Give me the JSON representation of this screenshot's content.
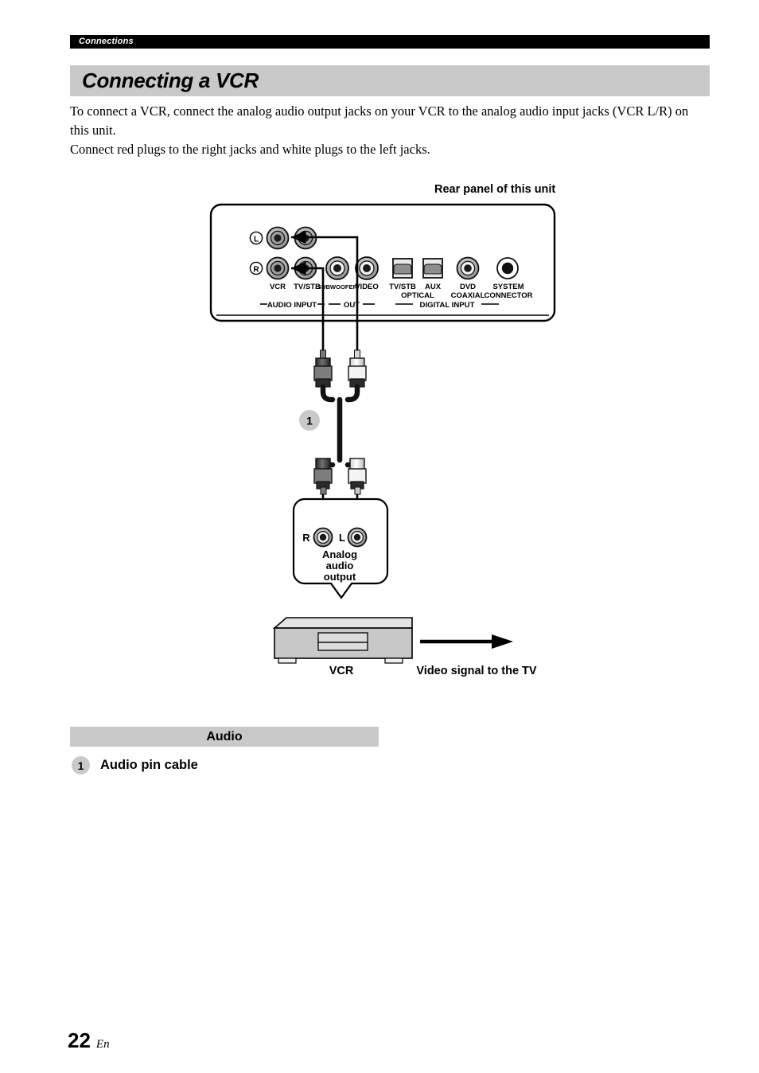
{
  "running_head": "Connections",
  "page_title": "Connecting a VCR",
  "intro": {
    "line1": "To connect a VCR, connect the analog audio output jacks on your VCR to the analog audio input jacks (VCR L/R) on",
    "line2": "this unit.",
    "line3": "Connect red plugs to the right jacks and white plugs to the left jacks."
  },
  "diagram": {
    "rear_panel_caption": "Rear panel of this unit",
    "channel_labels": {
      "left": "L",
      "right": "R"
    },
    "jack_labels": {
      "vcr": "VCR",
      "tv_stb": "TV/STB",
      "subwoofer": "SUBWOOFER",
      "video": "VIDEO",
      "optical_tv_stb": "TV/STB",
      "optical_aux": "AUX",
      "optical_word": "OPTICAL",
      "coaxial_dvd": "DVD",
      "coaxial_word": "COAXIAL",
      "system_line1": "SYSTEM",
      "system_line2": "CONNECTOR"
    },
    "group_labels": {
      "audio_input": "AUDIO INPUT",
      "out": "OUT",
      "digital_input": "DIGITAL INPUT"
    },
    "cable_badge": "1",
    "vcr_box": {
      "right_label": "R",
      "left_label": "L",
      "callout_line1": "Analog",
      "callout_line2": "audio",
      "callout_line3": "output",
      "device_label": "VCR",
      "video_arrow_label": "Video signal to the TV"
    }
  },
  "audio_section": {
    "heading": "Audio",
    "items": [
      {
        "badge": "1",
        "label": "Audio pin cable"
      }
    ]
  },
  "footer": {
    "page_number": "22",
    "language": "En"
  },
  "colors": {
    "band_gray": "#c9c9c9",
    "runhead_black": "#000000",
    "jack_gray": "#9a9a9a",
    "device_gray": "#c8c8c8"
  }
}
